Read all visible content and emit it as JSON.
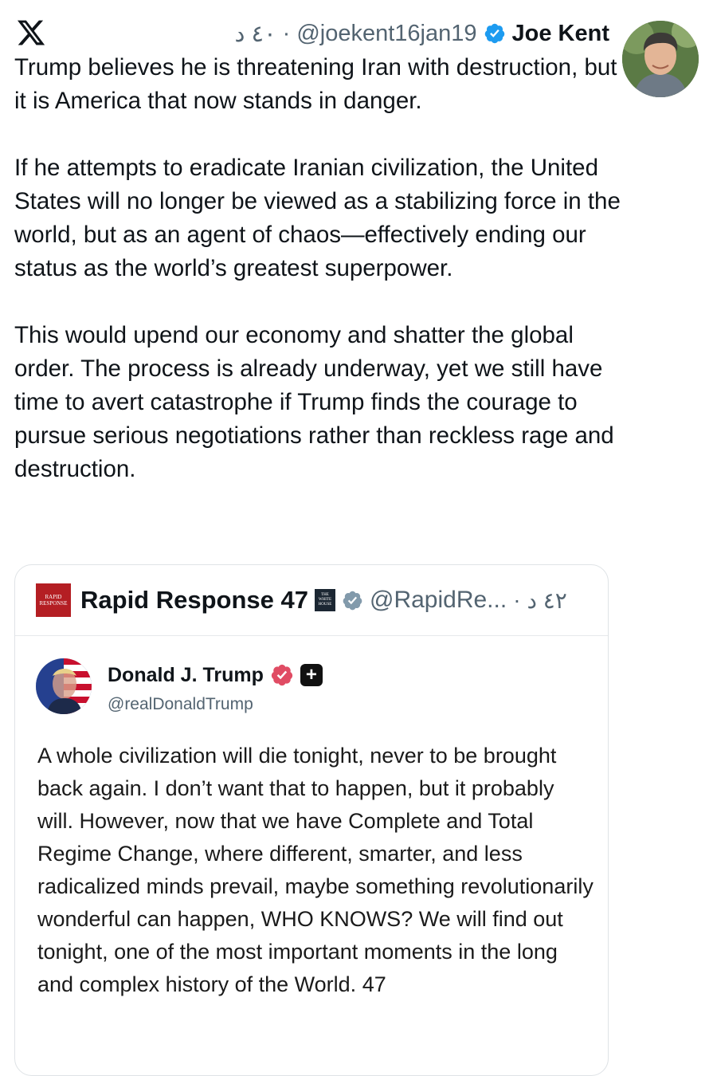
{
  "header": {
    "brand_icon": "x-logo-icon",
    "time": "٤٠ د",
    "separator": "·",
    "handle": "@joekent16jan19",
    "name": "Joe Kent",
    "verified_color": "#1d9bf0"
  },
  "post": {
    "paragraphs": [
      "Trump believes he is threatening Iran with destruction, but it is America that now stands in danger.",
      "If he attempts to eradicate Iranian civilization, the United States will no longer be viewed as a stabilizing force in the world, but as an agent of chaos—effectively ending our status as the world’s greatest superpower.",
      "This would upend our economy and shatter the global order. The process is already underway, yet we still have time to avert catastrophe if Trump finds the courage to pursue serious negotiations rather than reckless rage and destruction."
    ]
  },
  "quote": {
    "logo_text_1": "RAPID",
    "logo_text_2": "RESPONSE",
    "name": "Rapid Response 47",
    "affiliate_text_1": "THE",
    "affiliate_text_2": "WHITE",
    "affiliate_text_3": "HOUSE",
    "handle": "@RapidRe...",
    "separator": "·",
    "time": "٤٢ د",
    "badge_color": "#829aab",
    "embedded": {
      "name": "Donald J. Trump",
      "handle": "@realDonaldTrump",
      "badge_color": "#e04c64",
      "plus_label": "+",
      "text": "A whole civilization will die tonight, never to be brought back again. I don’t want that to happen, but it probably will. However, now that we have Complete and Total Regime Change, where different, smarter, and less radicalized minds prevail, maybe something revolutionarily wonderful can happen, WHO KNOWS? We will find out tonight, one of the most important moments in the long and complex history of the World. 47"
    }
  }
}
